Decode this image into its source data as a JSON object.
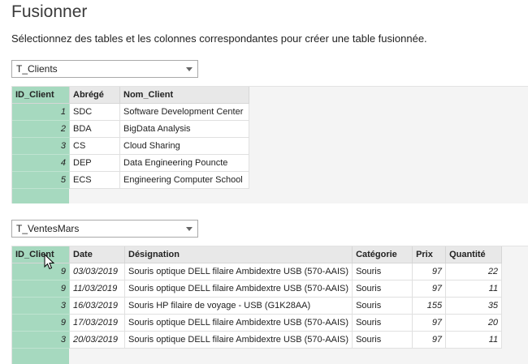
{
  "dialog": {
    "title": "Fusionner",
    "subtitle": "Sélectionnez des tables et les colonnes correspondantes pour créer une table fusionnée."
  },
  "table1": {
    "selected": "T_Clients",
    "columns": [
      "ID_Client",
      "Abrégé",
      "Nom_Client"
    ],
    "rows": [
      [
        "1",
        "SDC",
        "Software Development Center"
      ],
      [
        "2",
        "BDA",
        "BigData Analysis"
      ],
      [
        "3",
        "CS",
        "Cloud Sharing"
      ],
      [
        "4",
        "DEP",
        "Data Engineering Pouncte"
      ],
      [
        "5",
        "ECS",
        "Engineering Computer School"
      ]
    ]
  },
  "table2": {
    "selected": "T_VentesMars",
    "columns": [
      "ID_Client",
      "Date",
      "Désignation",
      "Catégorie",
      "Prix",
      "Quantité"
    ],
    "rows": [
      [
        "9",
        "03/03/2019",
        "Souris optique DELL filaire Ambidextre USB (570-AAIS)",
        "Souris",
        "97",
        "22"
      ],
      [
        "9",
        "11/03/2019",
        "Souris optique DELL filaire Ambidextre USB (570-AAIS)",
        "Souris",
        "97",
        "11"
      ],
      [
        "3",
        "16/03/2019",
        "Souris HP filaire de voyage - USB (G1K28AA)",
        "Souris",
        "155",
        "35"
      ],
      [
        "9",
        "17/03/2019",
        "Souris optique DELL filaire Ambidextre USB (570-AAIS)",
        "Souris",
        "97",
        "20"
      ],
      [
        "3",
        "20/03/2019",
        "Souris optique DELL filaire Ambidextre USB (570-AAIS)",
        "Souris",
        "97",
        "11"
      ]
    ]
  }
}
